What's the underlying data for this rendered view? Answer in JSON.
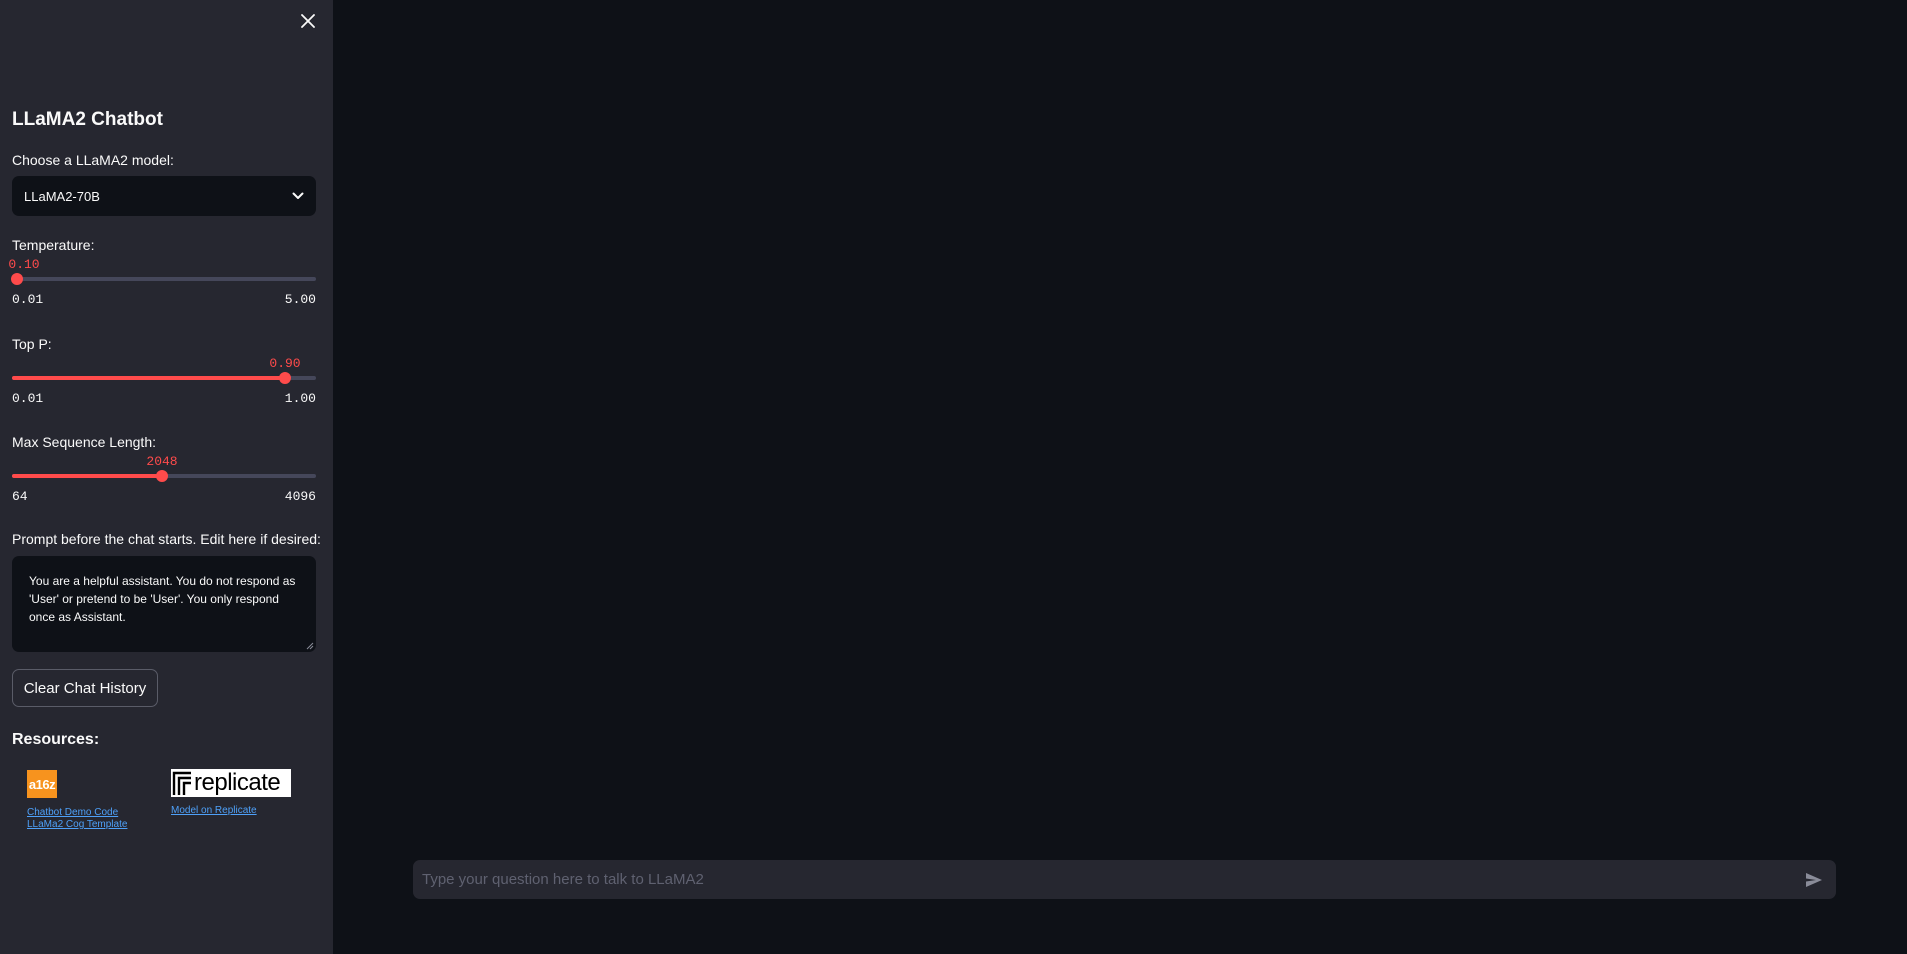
{
  "sidebar": {
    "close_icon": "close-icon",
    "title": "LLaMA2 Chatbot",
    "model": {
      "label": "Choose a LLaMA2 model:",
      "selected": "LLaMA2-70B",
      "icon": "chevron-down-icon"
    },
    "temperature": {
      "label": "Temperature:",
      "value": "0.10",
      "min": "0.01",
      "max": "5.00",
      "position": 0.018
    },
    "top_p": {
      "label": "Top P:",
      "value": "0.90",
      "min": "0.01",
      "max": "1.00",
      "position": 0.899
    },
    "max_length": {
      "label": "Max Sequence Length:",
      "value": "2048",
      "min": "64",
      "max": "4096",
      "position": 0.492
    },
    "prompt": {
      "label": "Prompt before the chat starts. Edit here if desired:",
      "value": "You are a helpful assistant. You do not respond as 'User' or pretend to be 'User'. You only respond once as Assistant."
    },
    "clear_button": "Clear Chat History",
    "resources": {
      "title": "Resources:",
      "a16z_logo_text": "a16z",
      "replicate_logo_text": "replicate",
      "links": {
        "demo_code": "Chatbot Demo Code",
        "cog_template": "LLaMa2 Cog Template",
        "replicate_model": "Model on Replicate"
      }
    }
  },
  "chat": {
    "placeholder": "Type your question here to talk to LLaMA2",
    "send_icon": "send-icon"
  },
  "colors": {
    "accent": "#ff4b4b",
    "sidebar_bg": "#262730",
    "main_bg": "#0e1117",
    "link": "#4ea0f8"
  }
}
